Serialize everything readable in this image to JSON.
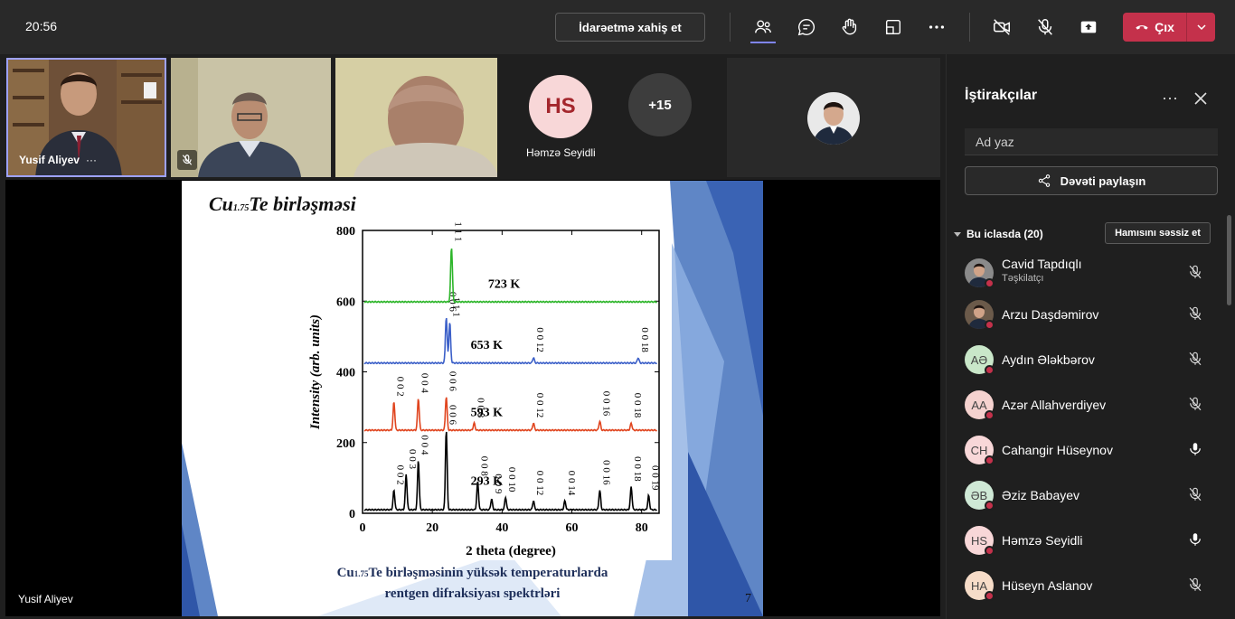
{
  "topbar": {
    "time": "20:56",
    "request_control_label": "İdarəetmə xahiş et",
    "leave_label": "Çıx",
    "icons": [
      "participants-icon",
      "chat-icon",
      "raise-hand-icon",
      "rooms-icon",
      "more-icon",
      "camera-off-icon",
      "mic-off-icon",
      "share-icon"
    ]
  },
  "tiles": {
    "tile1_name": "Yusif Aliyev",
    "tile1_more": "···",
    "hs_initials": "HS",
    "hs_name": "Həmzə Seyidli",
    "overflow_count": "+15"
  },
  "stage": {
    "presenter_name": "Yusif Aliyev",
    "slide": {
      "title_prefix": "Cu",
      "title_sub": "1.75",
      "title_suffix": "Te birləşməsi",
      "caption_line1_prefix": "Cu",
      "caption_line1_sub": "1.75",
      "caption_line1_suffix": "Te birləşməsinin yüksək temperaturlarda",
      "caption_line2": "rentgen difraksiyası spektrləri",
      "page_number": "7"
    }
  },
  "chart_data": {
    "type": "line",
    "title": "",
    "xlabel": "2 theta (degree)",
    "ylabel": "Intensity (arb. units)",
    "xlim": [
      0,
      85
    ],
    "ylim": [
      0,
      800
    ],
    "xticks": [
      0,
      20,
      40,
      60,
      80
    ],
    "yticks": [
      0,
      200,
      400,
      600,
      800
    ],
    "series": [
      {
        "name": "293 K",
        "color": "#000000",
        "baseline": 10,
        "peaks": [
          [
            9,
            55,
            "0 0 2"
          ],
          [
            12.5,
            100,
            "0 0 3"
          ],
          [
            16,
            140,
            "0 0 4"
          ],
          [
            24,
            225,
            "0 0 6"
          ],
          [
            33,
            80,
            "0 0 8"
          ],
          [
            37,
            30,
            "0 0 9"
          ],
          [
            41,
            35,
            "0 0 10"
          ],
          [
            49,
            25,
            "0 0 12"
          ],
          [
            58,
            25,
            "0 0 14"
          ],
          [
            68,
            55,
            "0 0 16"
          ],
          [
            77,
            65,
            "0 0 18"
          ],
          [
            82,
            40,
            "0 0 19"
          ]
        ]
      },
      {
        "name": "593 K",
        "color": "#e0451f",
        "baseline": 235,
        "peaks": [
          [
            9,
            80,
            "0 0 2"
          ],
          [
            16,
            90,
            "0 0 4"
          ],
          [
            24,
            95,
            "0 0 6"
          ],
          [
            32,
            20,
            "0 0 8"
          ],
          [
            49,
            20,
            "0 0 12"
          ],
          [
            68,
            25,
            "0 0 16"
          ],
          [
            77,
            20,
            "0 0 18"
          ]
        ]
      },
      {
        "name": "653 K",
        "color": "#3b5fc8",
        "baseline": 425,
        "peaks": [
          [
            24,
            130,
            "0 0 6"
          ],
          [
            25,
            115,
            "1 1 1"
          ],
          [
            49,
            15,
            "0 0 12"
          ],
          [
            79,
            15,
            "0 0 18"
          ]
        ]
      },
      {
        "name": "723 K",
        "color": "#2db52a",
        "baseline": 598,
        "peaks": [
          [
            25.5,
            155,
            "1 1 1"
          ]
        ]
      }
    ]
  },
  "panel": {
    "title": "İştirakçılar",
    "search_placeholder": "Ad yaz",
    "share_invite_label": "Dəvəti paylaşın",
    "in_meeting_label": "Bu iclasda (20)",
    "mute_all_label": "Hamısını səssiz et",
    "participants": [
      {
        "name": "Cavid Tapdıqlı",
        "role": "Təşkilatçı",
        "initials": "",
        "avatar_color": "#8a8a8a",
        "mic": "off"
      },
      {
        "name": "Arzu Daşdəmirov",
        "role": "",
        "initials": "",
        "avatar_color": "#6b5a4a",
        "mic": "off"
      },
      {
        "name": "Aydın Ələkbərov",
        "role": "",
        "initials": "AƏ",
        "avatar_color": "#c9e7c9",
        "mic": "off"
      },
      {
        "name": "Azər Allahverdiyev",
        "role": "",
        "initials": "AA",
        "avatar_color": "#f5d2cf",
        "mic": "off"
      },
      {
        "name": "Cahangir Hüseynov",
        "role": "",
        "initials": "CH",
        "avatar_color": "#f8d7d8",
        "mic": "on"
      },
      {
        "name": "Əziz Babayev",
        "role": "",
        "initials": "ƏB",
        "avatar_color": "#cfe9d6",
        "mic": "off"
      },
      {
        "name": "Həmzə Seyidli",
        "role": "",
        "initials": "HS",
        "avatar_color": "#f8d7d8",
        "mic": "on"
      },
      {
        "name": "Hüseyn Aslanov",
        "role": "",
        "initials": "HA",
        "avatar_color": "#f6dcc8",
        "mic": "off"
      }
    ]
  }
}
